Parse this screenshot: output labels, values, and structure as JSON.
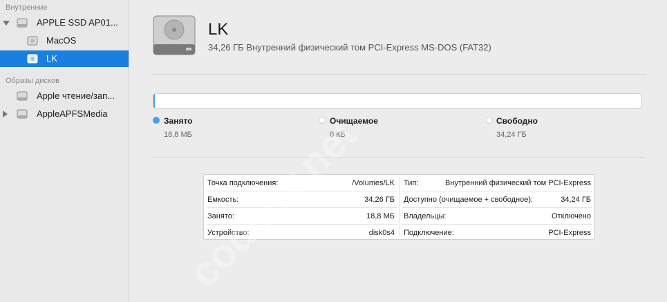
{
  "sidebar": {
    "internal_title": "Внутренние",
    "images_title": "Образы дисков",
    "items": [
      {
        "label": "APPLE SSD AP01..."
      },
      {
        "label": "MacOS"
      },
      {
        "label": "LK"
      },
      {
        "label": "Apple чтение/зап..."
      },
      {
        "label": "AppleAPFSMedia"
      }
    ]
  },
  "volume": {
    "name": "LK",
    "description": "34,26 ГБ Внутренний физический том PCI-Express MS-DOS (FAT32)"
  },
  "usage": {
    "used_fraction": 0.0005,
    "legend": [
      {
        "label": "Занято",
        "value": "18,8 МБ",
        "color": "#4a9df0"
      },
      {
        "label": "Очищаемое",
        "value": "0 КБ",
        "color": "#d8d8d8"
      },
      {
        "label": "Свободно",
        "value": "34,24 ГБ",
        "color": "#ffffff"
      }
    ]
  },
  "info": {
    "left": [
      {
        "key": "Точка подключения:",
        "value": "/Volumes/LK"
      },
      {
        "key": "Емкость:",
        "value": "34,26 ГБ"
      },
      {
        "key": "Занято:",
        "value": "18,8 МБ"
      },
      {
        "key": "Устройство:",
        "value": "disk0s4"
      }
    ],
    "right": [
      {
        "key": "Тип:",
        "value": "Внутренний физический том PCI-Express"
      },
      {
        "key": "Доступно (очищаемое + свободное):",
        "value": "34,24 ГБ"
      },
      {
        "key": "Владельцы:",
        "value": "Отключено"
      },
      {
        "key": "Подключение:",
        "value": "PCI-Express"
      }
    ]
  },
  "watermark": "codeby.net"
}
